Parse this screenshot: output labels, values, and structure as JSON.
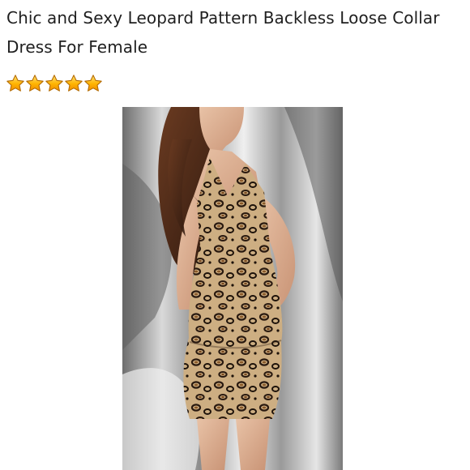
{
  "product": {
    "title": "Chic and Sexy Leopard Pattern Backless Loose Collar Dress For Female",
    "rating": 5,
    "rating_max": 5,
    "star_icon": "star-icon",
    "colors": {
      "star_fill": "#ffb400",
      "star_stroke": "#b36a00",
      "text": "#1f1f1f",
      "background": "#ffffff"
    }
  }
}
